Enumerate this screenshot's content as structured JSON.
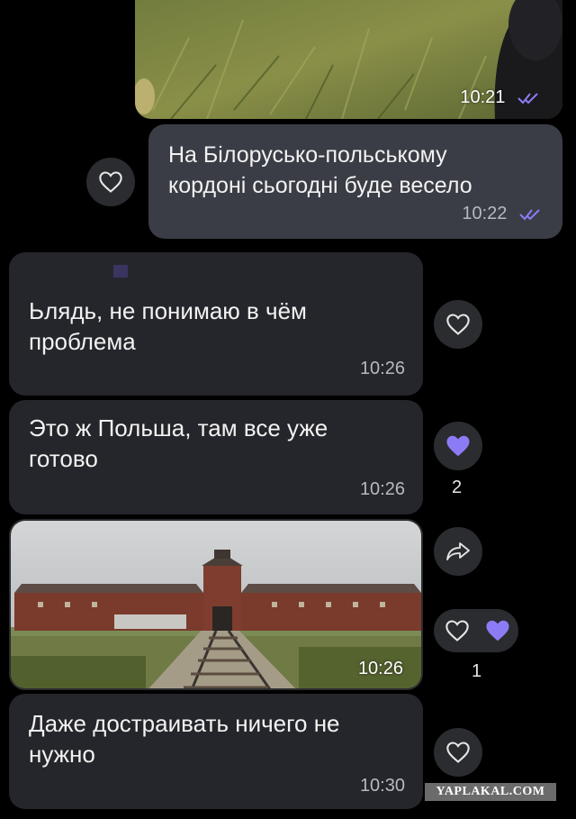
{
  "messages": [
    {
      "id": "m0",
      "kind": "photo",
      "direction": "outgoing",
      "time": "10:21",
      "read": true
    },
    {
      "id": "m1",
      "kind": "text",
      "direction": "outgoing",
      "lines": [
        "На Білорусько-польському",
        "кордоні сьогодні буде весело"
      ],
      "time": "10:22",
      "read": true
    },
    {
      "id": "m2",
      "kind": "text",
      "direction": "incoming",
      "lines": [
        "Ьлядь, не понимаю в чём",
        "проблема"
      ],
      "time": "10:26"
    },
    {
      "id": "m3",
      "kind": "text",
      "direction": "incoming",
      "lines": [
        "Это ж Польша, там все уже",
        "готово"
      ],
      "time": "10:26",
      "reaction_count": "2"
    },
    {
      "id": "m4",
      "kind": "photo",
      "direction": "incoming",
      "time": "10:26",
      "reaction_count": "1"
    },
    {
      "id": "m5",
      "kind": "text",
      "direction": "incoming",
      "lines": [
        "Даже достраивать ничего не",
        "нужно"
      ],
      "time": "10:30"
    }
  ],
  "colors": {
    "accent": "#8b7cf6",
    "incoming_bubble": "#25262b",
    "outgoing_bubble": "#3a3d45",
    "background": "#000000"
  },
  "icons": [
    "heart-outline-icon",
    "heart-filled-icon",
    "share-icon",
    "double-check-icon"
  ],
  "watermark": "YAPLAKAL.COM"
}
